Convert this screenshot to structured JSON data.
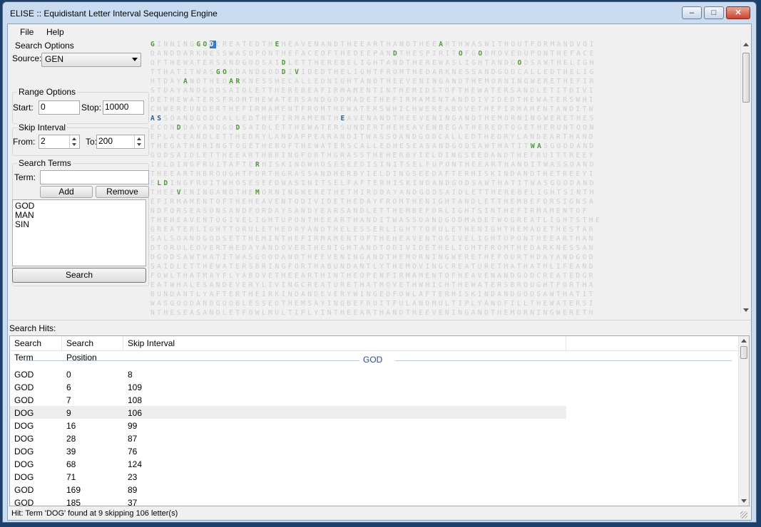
{
  "window": {
    "title": "ELISE :: Equidistant Letter Interval Sequencing Engine"
  },
  "menu": {
    "file": "File",
    "help": "Help"
  },
  "search_options": {
    "label": "Search Options",
    "source_label": "Source:",
    "source_value": "GEN"
  },
  "range_options": {
    "label": "Range Options",
    "start_label": "Start:",
    "start_value": "0",
    "stop_label": "Stop:",
    "stop_value": "10000"
  },
  "skip_interval": {
    "label": "Skip Interval",
    "from_label": "From:",
    "from_value": "2",
    "to_label": "To:",
    "to_value": "200"
  },
  "search_terms": {
    "label": "Search Terms",
    "term_label": "Term:",
    "term_value": "",
    "add_label": "Add",
    "remove_label": "Remove",
    "terms": [
      "GOD",
      "MAN",
      "SIN"
    ],
    "search_label": "Search"
  },
  "letter_grid": {
    "colors": {
      "normal": "#c8c8c8",
      "hit_green": "#4f9a3c",
      "hit_blue": "#2f5d8a",
      "selected_bg": "#3a78c8"
    },
    "rows": [
      "GINNINGGODCREATEDTHEHEAVENANDTHEEARTHANDTHEEARTHWASWITHOUTFORMANDVOI",
      "DANDDARKNESSWASUPONTHEFACEOFTHEDEEPANDTHESPIRITOFGODMOVEDUPONTHEFACE",
      "OFTHEWATERSANDGODSAIDLETTHEREBELIGHTANDTHEREWASLIGHTANDGODSAWTHELIGH",
      "TTHATITWASGOODANDGODDIVIDEDTHELIGHTFROMTHEDARKNESSANDGODCALLEDTHELIG",
      "HTDAYANDTHEDARKNESSHECALLEDNIGHTANDTHEEVENINGANDTHEMORNINGWERETHEFIR",
      "STDAYANDGODSAIDLETTHEREBEAFIRMAMENTINTHEMIDSTOFTHEWATERSANDLETITDIVI",
      "DETHEWATERSFROMTHEWATERSANDGODMADETHEFIRMAMENTANDDIVIDEDTHEWATERSWHI",
      "CHWEREUNDERTHEFIRMAMENTFROMTHEWATERSWHICHWEREABOVETHEFIRMAMENTANDITW",
      "ASSOANDGODCALLEDTHEFIRMAMENTHEAVENANDTHEEVENINGANDTHEMORNINGWERETHES",
      "ECONDDAYANDGODSAIDLETTHEWATERSUNDERTHEHEAVENBEGATHEREDTOGETHERUNTOON",
      "EPLACEANDLETTHEDRYLANDAPPEARANDITWASSOANDGODCALLEDTHEDRYLANDEARTHAND",
      "THEGATHERINGTOGETHEROFTHEWATERSCALLEDHESEASANDGODSAWTHATITWASGOODAND",
      "GODSAIDLETTHEEARTHBRINGFORTHGRASSTHEHERBYIELDINGSEEDANDTHEFRUITTREEY",
      "IELDINGFRUITAFTERHISKINDWHOSESEEDISINITSELFUPONTHEEARTHANDITWASSOAND",
      "THEEARTHBROUGHTFORTHGRASSANDHERBYIELDINGSEEDAFTERHISKINDANDTHETREEYI",
      "ELDINGFRUITWHOSESEEDWASINITSELFAFTERHISKINDANDGODSAWTHATITWASGOODAND",
      "THEEVENINGANDTHEMORNINGWERETHETHIRDDAYANDGODSAIDLETTHEREBELIGHTSINTH",
      "EFIRMAMENTOFTHEHEAVENTODIVIDETHEDAYFROMTHENIGHTANDLETTHEMBEFORSIGNSA",
      "NDFORSEASONSANDFORDAYSANDYEARSANDLETTHEMBEFORLIGHTSINTHEFIRMAMENTOF",
      "THEHEAVENTOGIVELIGHTUPONTHEEARTHANDITWASSOANDGODMADETWOGREATLIGHTSTHE",
      "GREATERLIGHTTORULETHEDAYANDTHELESSERLIGHTTORULETHENIGHTHEMADETHESTAR",
      "SALSOANDGODSETTHEMINTHEFIRMAMENTOFTHEHEAVENTOGIVELIGHTUPONTHEEARTHAN",
      "DTORULEOVERTHEDAYANDOVERTHENIGHTANDTODIVIDETHELIGHTFROMTHEDARKNESSAN",
      "DGODSAWTHATITWASGOODANDTHEEVENINGANDTHEMORNINGWERETHEFOURTHDAYANDGOD",
      "SAIDLETTHEWATERSBRINGFORTHABUNDANTLYTHEMOVINGCREATURETHATHATHLIFEAND",
      "FOWLTHATMAYFLYABOVETHEEARTHINTHEOPENFIRMAMENTOFHEAVENANDGODCREATEDGR",
      "EATWHALESANDEVERYLIVINGCREATURETHATMOVETHWHICHTHEWATERSBROUGHTFORTHA",
      "BUNDANTLYAFTERTHEIRKINDANDEVERYWINGEDFOWLAFTERHISKINDANDGODSAWTHATIT",
      "WASGOODANDGODBLESSEDTHEMSAYINGBEFRUITFULANDMULTIPLYANDFILLTHEWATERSI",
      "NTHESEASANDLETFOWLMULTIPLYINTHEEARTHANDTHEEVENINGANDTHEMORNINGWERETH"
    ]
  },
  "hits": {
    "title": "Search Hits:",
    "columns": [
      "Search Term",
      "Search Position",
      "Skip Interval"
    ],
    "group_label": "GOD",
    "rows": [
      {
        "term": "GOD",
        "position": "0",
        "skip": "8"
      },
      {
        "term": "GOD",
        "position": "6",
        "skip": "109"
      },
      {
        "term": "GOD",
        "position": "7",
        "skip": "108"
      },
      {
        "term": "DOG",
        "position": "9",
        "skip": "106"
      },
      {
        "term": "DOG",
        "position": "16",
        "skip": "99"
      },
      {
        "term": "DOG",
        "position": "28",
        "skip": "87"
      },
      {
        "term": "DOG",
        "position": "39",
        "skip": "76"
      },
      {
        "term": "DOG",
        "position": "68",
        "skip": "124"
      },
      {
        "term": "DOG",
        "position": "71",
        "skip": "23"
      },
      {
        "term": "GOD",
        "position": "169",
        "skip": "89"
      },
      {
        "term": "GOD",
        "position": "185",
        "skip": "37"
      }
    ]
  },
  "status": {
    "text": "Hit: Term 'DOG' found at 9 skipping 106 letter(s)"
  }
}
